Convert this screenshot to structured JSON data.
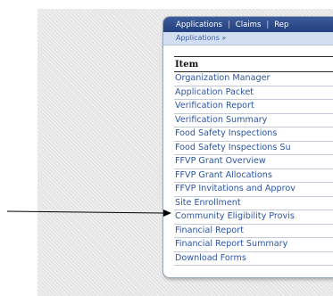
{
  "nav": {
    "tabs": [
      "Applications",
      "Claims",
      "Rep"
    ]
  },
  "breadcrumb": "Applications »",
  "table": {
    "header": "Item",
    "items": [
      "Organization Manager",
      "Application Packet",
      "Verification Report",
      "Verification Summary",
      "Food Safety Inspections",
      "Food Safety Inspections Su",
      "FFVP Grant Overview",
      "FFVP Grant Allocations",
      "FFVP Invitations and Approv",
      "Site Enrollment",
      "Community Eligibility Provis",
      "Financial Report",
      "Financial Report Summary",
      "Download Forms"
    ]
  }
}
